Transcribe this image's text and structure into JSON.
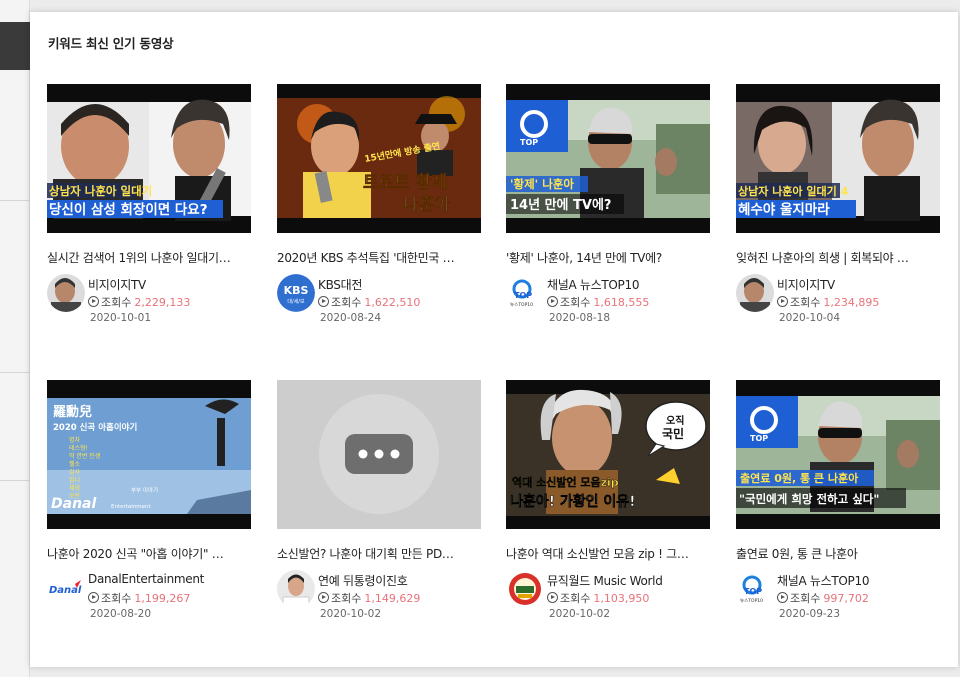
{
  "section": {
    "title": "키워드 최신 인기 동영상"
  },
  "views_label": "조회수",
  "videos": [
    {
      "title": "실시간 검색어 1위의 나훈아 일대기…",
      "channel": "비지이지TV",
      "views": "2,229,133",
      "date": "2020-10-01",
      "caption_top": "상남자 나훈아 일대기",
      "caption_bottom": "당신이 삼성 회장이면 다요?"
    },
    {
      "title": "2020년 KBS 추석특집 '대한민국 …",
      "channel": "KBS대전",
      "views": "1,622,510",
      "date": "2020-08-24",
      "avatar_text": "KBS",
      "avatar_sub": "대/세/보",
      "caption_small": "15년만에 방송 출연",
      "caption_top": "트로트 황제",
      "caption_bottom": "나훈아"
    },
    {
      "title": "'황제' 나훈아, 14년 만에 TV에?",
      "channel": "채널A 뉴스TOP10",
      "views": "1,618,555",
      "date": "2020-08-18",
      "avatar_text": "TOP",
      "avatar_sub": "뉴스TOP10",
      "caption_top": "'황제' 나훈아",
      "caption_bottom": "14년 만에 TV에?"
    },
    {
      "title": "잊혀진 나훈아의 희생 | 회복되야 …",
      "channel": "비지이지TV",
      "views": "1,234,895",
      "date": "2020-10-04",
      "caption_top": "상남자 나훈아 일대기 4",
      "caption_bottom": "혜수야 울지마라"
    },
    {
      "title": "나훈아 2020 신곡 \"아홉 이야기\" …",
      "channel": "DanalEntertainment",
      "views": "1,199,267",
      "date": "2020-08-20",
      "avatar_text": "Danal",
      "caption_top": "羅勳兒",
      "caption_bottom": "2020 신곡 아홉이야기",
      "list": [
        "명자",
        "테스형!",
        "딱 한번 인생",
        "웰소",
        "감사",
        "엄니",
        "체념",
        "모란"
      ],
      "logo": "Danal",
      "logo_sub": "Entertainment",
      "tag": "부부 이야기"
    },
    {
      "title": "소신발언? 나훈아 대기획 만든 PD…",
      "channel": "연예 뒤통령이진호",
      "views": "1,149,629",
      "date": "2020-10-02"
    },
    {
      "title": "나훈아 역대 소신발언 모음 zip ! 그…",
      "channel": "뮤직월드 Music World",
      "views": "1,103,950",
      "date": "2020-10-02",
      "bubble": "오직\n국민",
      "caption_top": "역대 소신발언 모음zip",
      "caption_bottom": "나훈아! 가황인 이유!"
    },
    {
      "title": "출연료 0원, 통 큰 나훈아",
      "channel": "채널A 뉴스TOP10",
      "views": "997,702",
      "date": "2020-09-23",
      "avatar_text": "TOP",
      "avatar_sub": "뉴스TOP10",
      "caption_top": "출연료 0원, 통 큰 나훈아",
      "caption_bottom": "\"국민에게 희망 전하고 싶다\""
    }
  ],
  "colors": {
    "accent_views": "#e9727a",
    "caption_yellow": "#ffe44d",
    "caption_blue": "#1f5fd4"
  }
}
